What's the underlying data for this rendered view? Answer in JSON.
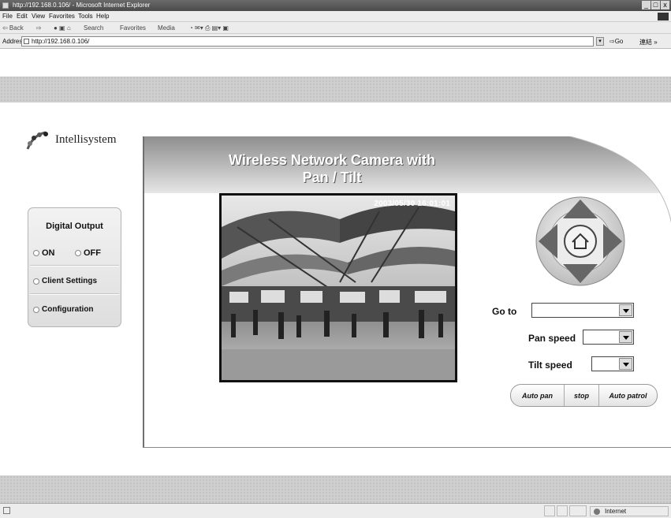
{
  "browser": {
    "title": "http://192.168.0.106/ - Microsoft Internet Explorer",
    "window_buttons": [
      "_",
      "□",
      "x"
    ],
    "menu": [
      "File",
      "Edit",
      "View",
      "Favorites",
      "Tools",
      "Help"
    ],
    "toolbar": {
      "back": "⇦ Back",
      "forward": "⇨",
      "search": "Search",
      "favorites": "Favorites",
      "media": "Media"
    },
    "address_label": "Address",
    "address_value": "http://192.168.0.106/",
    "go_label": "Go",
    "links_label": "連結 »",
    "status_zone": "Internet"
  },
  "logo": {
    "text": "Intellisystem"
  },
  "left_panel": {
    "digital_output_title": "Digital Output",
    "on_label": "ON",
    "off_label": "OFF",
    "client_settings_label": "Client Settings",
    "configuration_label": "Configuration"
  },
  "main": {
    "title_line1": "Wireless Network Camera with",
    "title_line2": "Pan / Tilt",
    "timestamp": "2003/05/30  16:01:01",
    "goto_label": "Go to",
    "pan_speed_label": "Pan speed",
    "tilt_speed_label": "Tilt speed",
    "buttons": {
      "auto_pan": "Auto pan",
      "stop": "stop",
      "auto_patrol": "Auto patrol"
    }
  },
  "icons": [
    "ie-page-icon",
    "intellisystem-logo-icon",
    "arrow-up-icon",
    "arrow-down-icon",
    "arrow-left-icon",
    "arrow-right-icon",
    "home-icon",
    "dropdown-arrow-icon",
    "internet-zone-icon"
  ]
}
